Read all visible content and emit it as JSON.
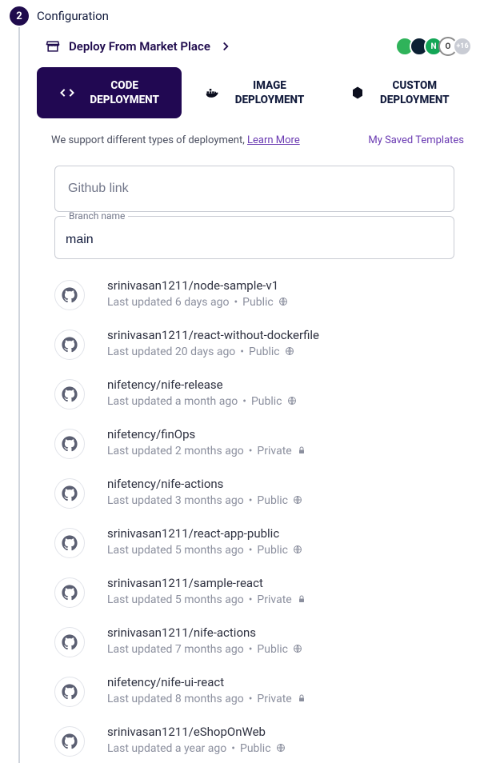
{
  "step": {
    "number": "2",
    "title": "Configuration"
  },
  "marketplace": {
    "label": "Deploy From Market Place",
    "more_count": "+16"
  },
  "tabs": {
    "code": "CODE DEPLOYMENT",
    "image": "IMAGE DEPLOYMENT",
    "custom": "CUSTOM DEPLOYMENT"
  },
  "support": {
    "text": "We support different types of deployment, ",
    "learn": "Learn More"
  },
  "saved_templates": "My Saved Templates",
  "form": {
    "github_placeholder": "Github link",
    "branch_label": "Branch name",
    "branch_value": "main"
  },
  "repos": [
    {
      "name": "srinivasan1211/node-sample-v1",
      "updated": "Last updated 6 days ago",
      "visibility": "Public"
    },
    {
      "name": "srinivasan1211/react-without-dockerfile",
      "updated": "Last updated 20 days ago",
      "visibility": "Public"
    },
    {
      "name": "nifetency/nife-release",
      "updated": "Last updated a month ago",
      "visibility": "Public"
    },
    {
      "name": "nifetency/finOps",
      "updated": "Last updated 2 months ago",
      "visibility": "Private"
    },
    {
      "name": "nifetency/nife-actions",
      "updated": "Last updated 3 months ago",
      "visibility": "Public"
    },
    {
      "name": "srinivasan1211/react-app-public",
      "updated": "Last updated 5 months ago",
      "visibility": "Public"
    },
    {
      "name": "srinivasan1211/sample-react",
      "updated": "Last updated 5 months ago",
      "visibility": "Private"
    },
    {
      "name": "srinivasan1211/nife-actions",
      "updated": "Last updated 7 months ago",
      "visibility": "Public"
    },
    {
      "name": "nifetency/nife-ui-react",
      "updated": "Last updated 8 months ago",
      "visibility": "Private"
    },
    {
      "name": "srinivasan1211/eShopOnWeb",
      "updated": "Last updated a year ago",
      "visibility": "Public"
    }
  ]
}
